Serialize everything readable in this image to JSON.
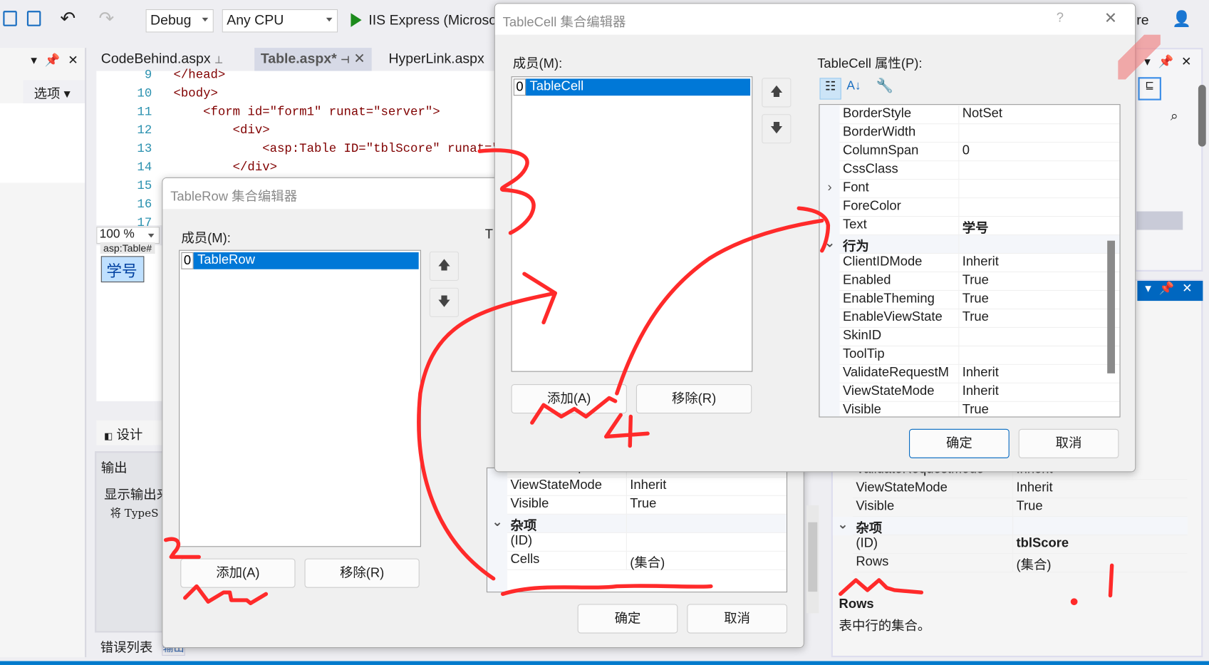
{
  "toolbar": {
    "config": "Debug",
    "platform": "Any CPU",
    "run_label": "IIS Express (Microsof",
    "right_text": "re"
  },
  "left_panel": {
    "options_label": "选项 ▾"
  },
  "tabs": [
    {
      "label": "CodeBehind.aspx",
      "active": false
    },
    {
      "label": "Table.aspx*",
      "active": true
    },
    {
      "label": "HyperLink.aspx",
      "active": false
    }
  ],
  "code": {
    "lines": [
      {
        "n": "9",
        "t": "</head>"
      },
      {
        "n": "10",
        "t": "<body>"
      },
      {
        "n": "11",
        "t": "    <form id=\"form1\" runat=\"server\">"
      },
      {
        "n": "12",
        "t": "        <div>"
      },
      {
        "n": "13",
        "t": "            <asp:Table ID=\"tblScore\" runat=\"s"
      },
      {
        "n": "14",
        "t": "        </div>"
      },
      {
        "n": "15",
        "t": ""
      },
      {
        "n": "16",
        "t": ""
      },
      {
        "n": "17",
        "t": ""
      }
    ]
  },
  "editor": {
    "zoom": "100 %",
    "design_tag": "asp:Table#",
    "design_cell": "学号",
    "design_tab": "设计"
  },
  "output": {
    "title": "输出",
    "show_from": "显示输出来",
    "line": "将 TypeS",
    "bottom_tab": "错误列表",
    "bottom_tab2": "输出"
  },
  "row_dialog": {
    "title": "TableRow 集合编辑器",
    "members_label": "成员(M):",
    "props_label": "T",
    "members": [
      {
        "index": "0",
        "name": "TableRow"
      }
    ],
    "props": [
      {
        "n": "ValidateRequestM",
        "v": "Inherit"
      },
      {
        "n": "ViewStateMode",
        "v": "Inherit"
      },
      {
        "n": "Visible",
        "v": "True"
      },
      {
        "n": "杂项",
        "v": "",
        "cat": true
      },
      {
        "n": "(ID)",
        "v": ""
      },
      {
        "n": "Cells",
        "v": "(集合)"
      }
    ],
    "add": "添加(A)",
    "remove": "移除(R)",
    "ok": "确定",
    "cancel": "取消"
  },
  "cell_dialog": {
    "title": "TableCell 集合编辑器",
    "help": "?",
    "members_label": "成员(M):",
    "props_label": "TableCell 属性(P):",
    "members": [
      {
        "index": "0",
        "name": "TableCell"
      }
    ],
    "props": [
      {
        "n": "BorderStyle",
        "v": "NotSet"
      },
      {
        "n": "BorderWidth",
        "v": ""
      },
      {
        "n": "ColumnSpan",
        "v": "0"
      },
      {
        "n": "CssClass",
        "v": ""
      },
      {
        "n": "Font",
        "v": "",
        "expand": true
      },
      {
        "n": "ForeColor",
        "v": ""
      },
      {
        "n": "Text",
        "v": "学号",
        "bold": true
      },
      {
        "n": "行为",
        "v": "",
        "cat": true
      },
      {
        "n": "ClientIDMode",
        "v": "Inherit"
      },
      {
        "n": "Enabled",
        "v": "True"
      },
      {
        "n": "EnableTheming",
        "v": "True"
      },
      {
        "n": "EnableViewState",
        "v": "True"
      },
      {
        "n": "SkinID",
        "v": ""
      },
      {
        "n": "ToolTip",
        "v": ""
      },
      {
        "n": "ValidateRequestM",
        "v": "Inherit"
      },
      {
        "n": "ViewStateMode",
        "v": "Inherit"
      },
      {
        "n": "Visible",
        "v": "True"
      }
    ],
    "add": "添加(A)",
    "remove": "移除(R)",
    "ok": "确定",
    "cancel": "取消"
  },
  "properties_panel": {
    "props": [
      {
        "n": "ValidateRequestMode",
        "v": "Inherit"
      },
      {
        "n": "ViewStateMode",
        "v": "Inherit"
      },
      {
        "n": "Visible",
        "v": "True"
      },
      {
        "n": "杂项",
        "v": "",
        "cat": true
      },
      {
        "n": "(ID)",
        "v": "tblScore",
        "bold": true
      },
      {
        "n": "Rows",
        "v": "(集合)"
      }
    ],
    "desc_title": "Rows",
    "desc_text": "表中行的集合。"
  },
  "annotations": {
    "numbers": [
      "1",
      "2",
      "3",
      "4"
    ],
    "color": "#ff2a2a"
  },
  "colors": {
    "accent": "#0078d7",
    "statusbar": "#007acc",
    "annotation": "#ff2a2a"
  }
}
